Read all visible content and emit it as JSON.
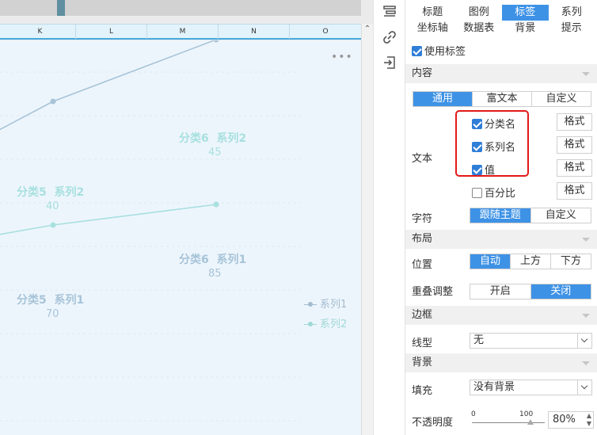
{
  "sheet": {
    "columns": [
      "K",
      "L",
      "M",
      "N",
      "O"
    ]
  },
  "chart_data": {
    "type": "line",
    "categories": [
      "分类5",
      "分类6"
    ],
    "series": [
      {
        "name": "系列1",
        "values": [
          70,
          85
        ]
      },
      {
        "name": "系列2",
        "values": [
          40,
          45
        ]
      }
    ],
    "labels": {
      "s1": [
        {
          "cat": "分类5",
          "ser": "系列1",
          "val": "70"
        },
        {
          "cat": "分类6",
          "ser": "系列1",
          "val": "85"
        }
      ],
      "s2": [
        {
          "cat": "分类5",
          "ser": "系列2",
          "val": "40"
        },
        {
          "cat": "分类6",
          "ser": "系列2",
          "val": "45"
        }
      ]
    },
    "legend": [
      "系列1",
      "系列2"
    ],
    "legend_position": "right",
    "grid": true,
    "colors": {
      "系列1": "#a7c4d8",
      "系列2": "#a7e0df"
    },
    "more_icon": "•••"
  },
  "toolbar": {
    "icons": [
      "panel-icon",
      "link-icon",
      "import-icon"
    ]
  },
  "panel": {
    "tabs": [
      "标题",
      "图例",
      "标签",
      "系列",
      "坐标轴",
      "数据表",
      "背景",
      "提示"
    ],
    "active_tab": "标签",
    "use_label": "使用标签",
    "content_section": "内容",
    "content_modes": [
      "通用",
      "富文本",
      "自定义"
    ],
    "text_label": "文本",
    "text_options": [
      {
        "label": "分类名",
        "checked": true,
        "button": "格式"
      },
      {
        "label": "系列名",
        "checked": true,
        "button": "格式"
      },
      {
        "label": "值",
        "checked": true,
        "button": "格式"
      },
      {
        "label": "百分比",
        "checked": false,
        "button": "格式"
      }
    ],
    "char_label": "字符",
    "char_modes": [
      "跟随主题",
      "自定义"
    ],
    "layout_section": "布局",
    "position_label": "位置",
    "position_modes": [
      "自动",
      "上方",
      "下方"
    ],
    "overlap_label": "重叠调整",
    "overlap_modes": [
      "开启",
      "关闭"
    ],
    "border_section": "边框",
    "line_type_label": "线型",
    "line_type_value": "无",
    "background_section": "背景",
    "fill_label": "填充",
    "fill_value": "没有背景",
    "opacity_label": "不透明度",
    "opacity_min": "0",
    "opacity_max": "100",
    "opacity_value": "80%",
    "opacity_level": 0.8,
    "accent_color": "#3e92e6"
  }
}
